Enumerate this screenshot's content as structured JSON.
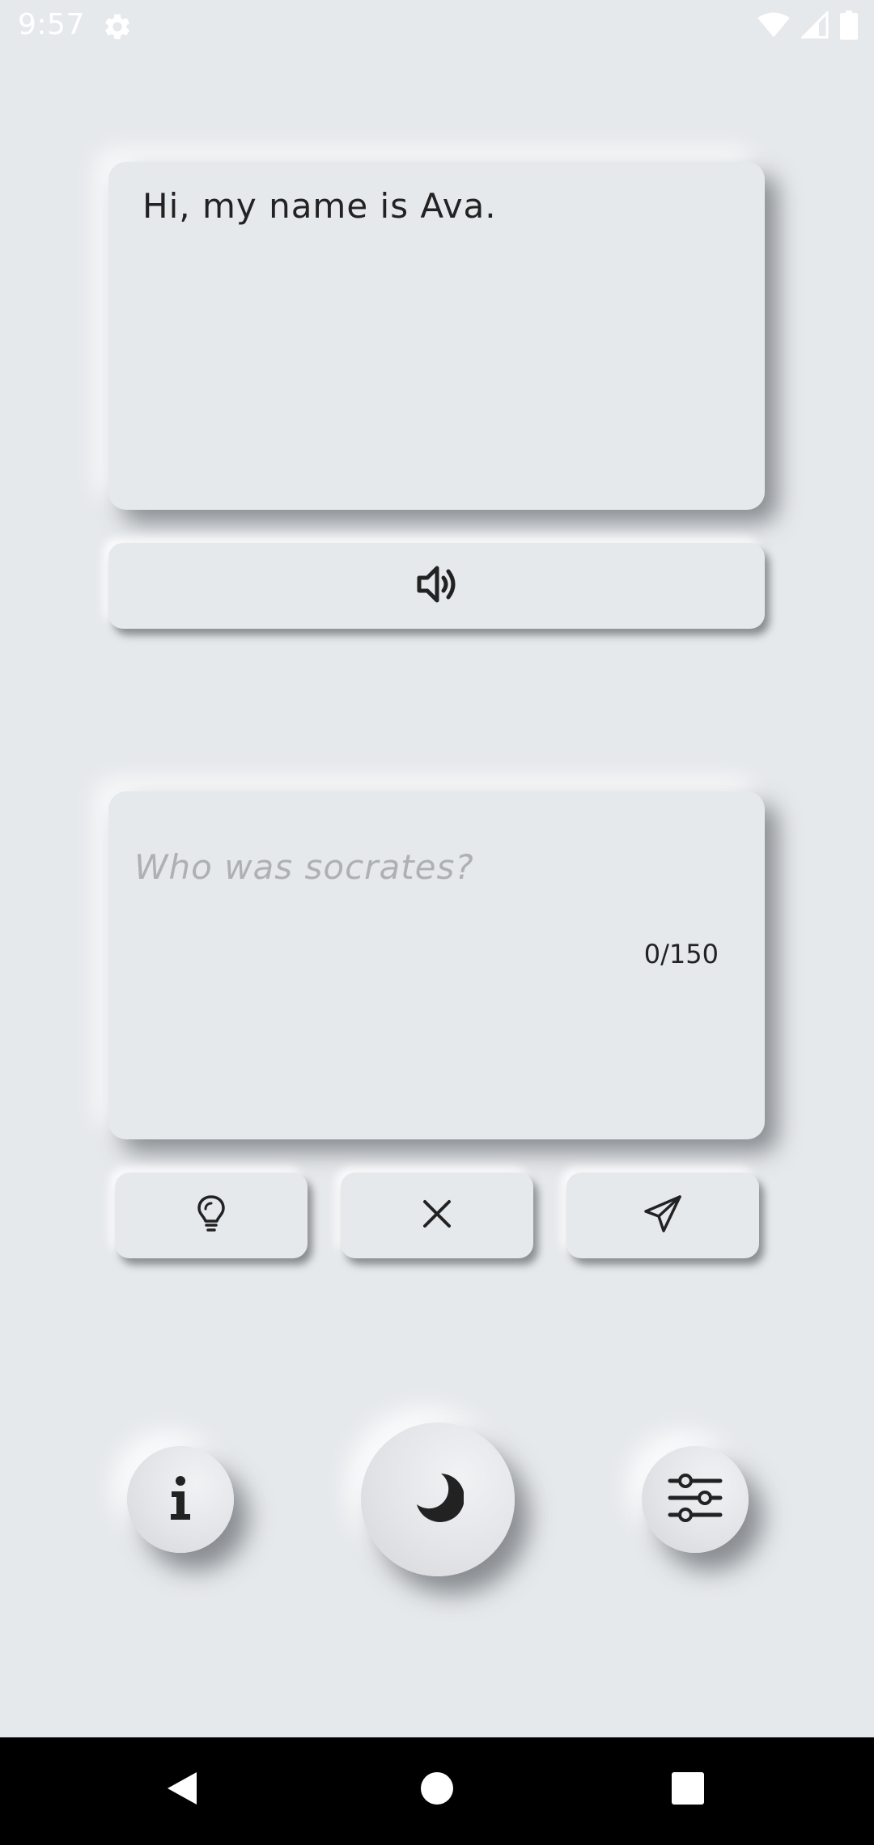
{
  "status_bar": {
    "time": "9:57",
    "icons": [
      "gear-icon",
      "wifi-icon",
      "signal-icon",
      "battery-icon"
    ]
  },
  "output": {
    "text": "Hi, my name is Ava."
  },
  "speak_button": {
    "icon": "speaker-icon"
  },
  "input": {
    "placeholder": "Who was socrates?",
    "value": "",
    "char_count": "0/150"
  },
  "actions": [
    {
      "name": "hint",
      "icon": "lightbulb-icon"
    },
    {
      "name": "clear",
      "icon": "close-icon"
    },
    {
      "name": "send",
      "icon": "paper-plane-icon"
    }
  ],
  "bottom_controls": [
    {
      "name": "info",
      "icon": "info-icon"
    },
    {
      "name": "theme",
      "icon": "moon-icon"
    },
    {
      "name": "settings",
      "icon": "sliders-icon"
    }
  ],
  "nav_bar": {
    "icons": [
      "back-icon",
      "home-icon",
      "recents-icon"
    ]
  },
  "colors": {
    "background": "#e6e9ec",
    "text": "#222222",
    "placeholder": "#aeb0b3",
    "icon": "#222222"
  }
}
